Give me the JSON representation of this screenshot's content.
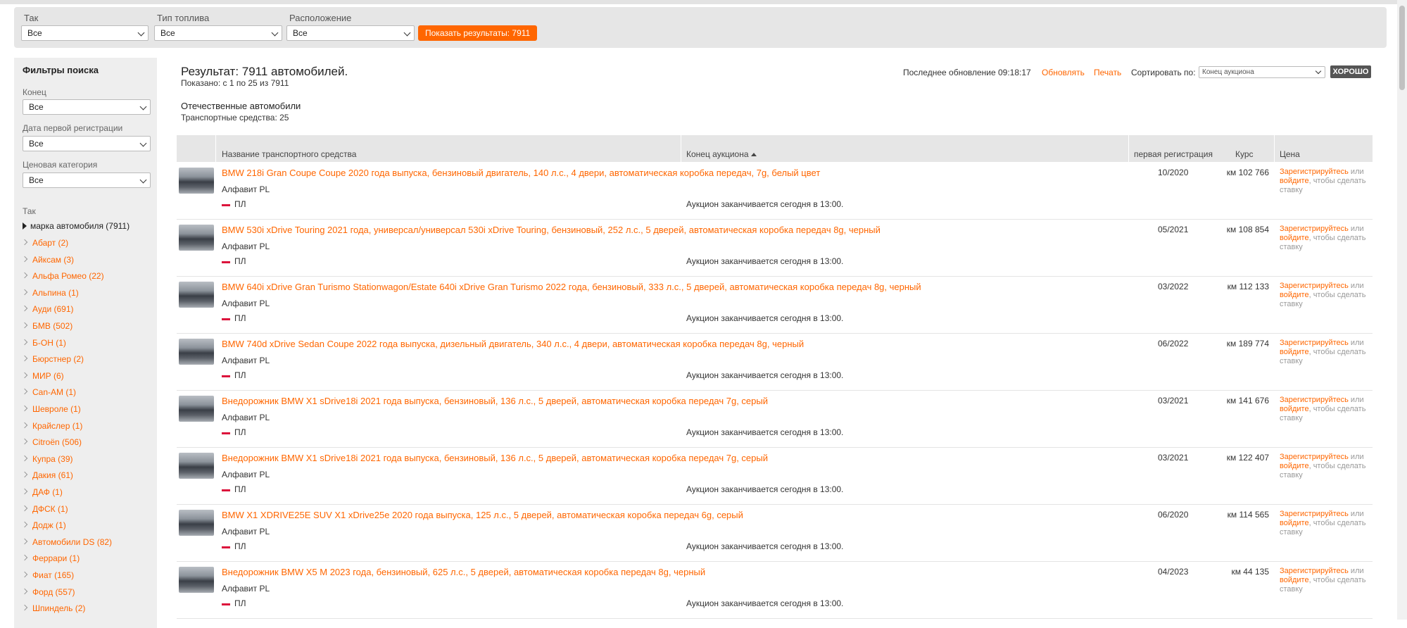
{
  "filters": {
    "make": {
      "label": "Так",
      "value": "Все"
    },
    "fuel": {
      "label": "Тип топлива",
      "value": "Все"
    },
    "location": {
      "label": "Расположение",
      "value": "Все"
    },
    "show_button": "Показать результаты: 7911"
  },
  "sidebar": {
    "title": "Фильтры поиска",
    "end": {
      "label": "Конец",
      "value": "Все"
    },
    "first_reg": {
      "label": "Дата первой регистрации",
      "value": "Все"
    },
    "price_cat": {
      "label": "Ценовая категория",
      "value": "Все"
    },
    "tak_label": "Так",
    "brand_header": "марка автомобиля (7911)",
    "makes": [
      "Абарт (2)",
      "Айксам (3)",
      "Альфа Ромео (22)",
      "Альпина (1)",
      "Ауди (691)",
      "БМВ (502)",
      "Б-ОН (1)",
      "Бюрстнер (2)",
      "МИР (6)",
      "Can-AM (1)",
      "Шевроле (1)",
      "Крайслер (1)",
      "Citroën (506)",
      "Купра (39)",
      "Дакия (61)",
      "ДАФ (1)",
      "ДФСК (1)",
      "Додж (1)",
      "Автомобили DS (82)",
      "Феррари (1)",
      "Фиат (165)",
      "Форд (557)",
      "Шпиндель (2)"
    ]
  },
  "results": {
    "title": "Результат: 7911 автомобилей.",
    "shown": "Показано: с 1 по 25 из 7911",
    "domestic": "Отечественные автомобили",
    "vehicle_count": "Транспортные средства: 25"
  },
  "toolbar": {
    "last_update": "Последнее обновление 09:18:17",
    "refresh": "Обновлять",
    "print": "Печать",
    "sort_label": "Сортировать по:",
    "sort_value": "Конец аукциона",
    "ok": "ХОРОШО"
  },
  "table": {
    "headers": {
      "name": "Название транспортного средства",
      "auction_end": "Конец аукциона",
      "first_reg": "первая регистрация",
      "course": "Курс",
      "price": "Цена"
    },
    "rows": [
      {
        "title": "BMW 218i Gran Coupe Coupe 2020 года выпуска, бензиновый двигатель, 140 л.с., 4 двери, автоматическая коробка передач, 7g, белый цвет",
        "seller": "Алфавит PL",
        "country": "ПЛ",
        "auction_end": "Аукцион заканчивается сегодня в 13:00.",
        "reg": "10/2020",
        "km": "км 102 766"
      },
      {
        "title": "BMW 530i xDrive Touring 2021 года, универсал/универсал 530i xDrive Touring, бензиновый, 252 л.с., 5 дверей, автоматическая коробка передач 8g, черный",
        "seller": "Алфавит PL",
        "country": "ПЛ",
        "auction_end": "Аукцион заканчивается сегодня в 13:00.",
        "reg": "05/2021",
        "km": "км 108 854"
      },
      {
        "title": "BMW 640i xDrive Gran Turismo Stationwagon/Estate 640i xDrive Gran Turismo 2022 года, бензиновый, 333 л.с., 5 дверей, автоматическая коробка передач 8g, черный",
        "seller": "Алфавит PL",
        "country": "ПЛ",
        "auction_end": "Аукцион заканчивается сегодня в 13:00.",
        "reg": "03/2022",
        "km": "км 112 133"
      },
      {
        "title": "BMW 740d xDrive Sedan Coupe 2022 года выпуска, дизельный двигатель, 340 л.с., 4 двери, автоматическая коробка передач 8g, черный",
        "seller": "Алфавит PL",
        "country": "ПЛ",
        "auction_end": "Аукцион заканчивается сегодня в 13:00.",
        "reg": "06/2022",
        "km": "км 189 774"
      },
      {
        "title": "Внедорожник BMW X1 sDrive18i 2021 года выпуска, бензиновый, 136 л.с., 5 дверей, автоматическая коробка передач 7g, серый",
        "seller": "Алфавит PL",
        "country": "ПЛ",
        "auction_end": "Аукцион заканчивается сегодня в 13:00.",
        "reg": "03/2021",
        "km": "км 141 676"
      },
      {
        "title": "Внедорожник BMW X1 sDrive18i 2021 года выпуска, бензиновый, 136 л.с., 5 дверей, автоматическая коробка передач 7g, серый",
        "seller": "Алфавит PL",
        "country": "ПЛ",
        "auction_end": "Аукцион заканчивается сегодня в 13:00.",
        "reg": "03/2021",
        "km": "км 122 407"
      },
      {
        "title": "BMW X1 XDRIVE25E SUV X1 xDrive25e 2020 года выпуска, 125 л.с., 5 дверей, автоматическая коробка передач 6g, серый",
        "seller": "Алфавит PL",
        "country": "ПЛ",
        "auction_end": "Аукцион заканчивается сегодня в 13:00.",
        "reg": "06/2020",
        "km": "км 114 565"
      },
      {
        "title": "Внедорожник BMW X5 M 2023 года, бензиновый, 625 л.с., 5 дверей, автоматическая коробка передач 8g, черный",
        "seller": "Алфавит PL",
        "country": "ПЛ",
        "auction_end": "Аукцион заканчивается сегодня в 13:00.",
        "reg": "04/2023",
        "km": "км 44 135"
      }
    ],
    "price_cta": {
      "register": "Зарегистрируйтесь",
      "or": "или",
      "login": "войдите",
      "rest": ", чтобы сделать ставку"
    }
  }
}
